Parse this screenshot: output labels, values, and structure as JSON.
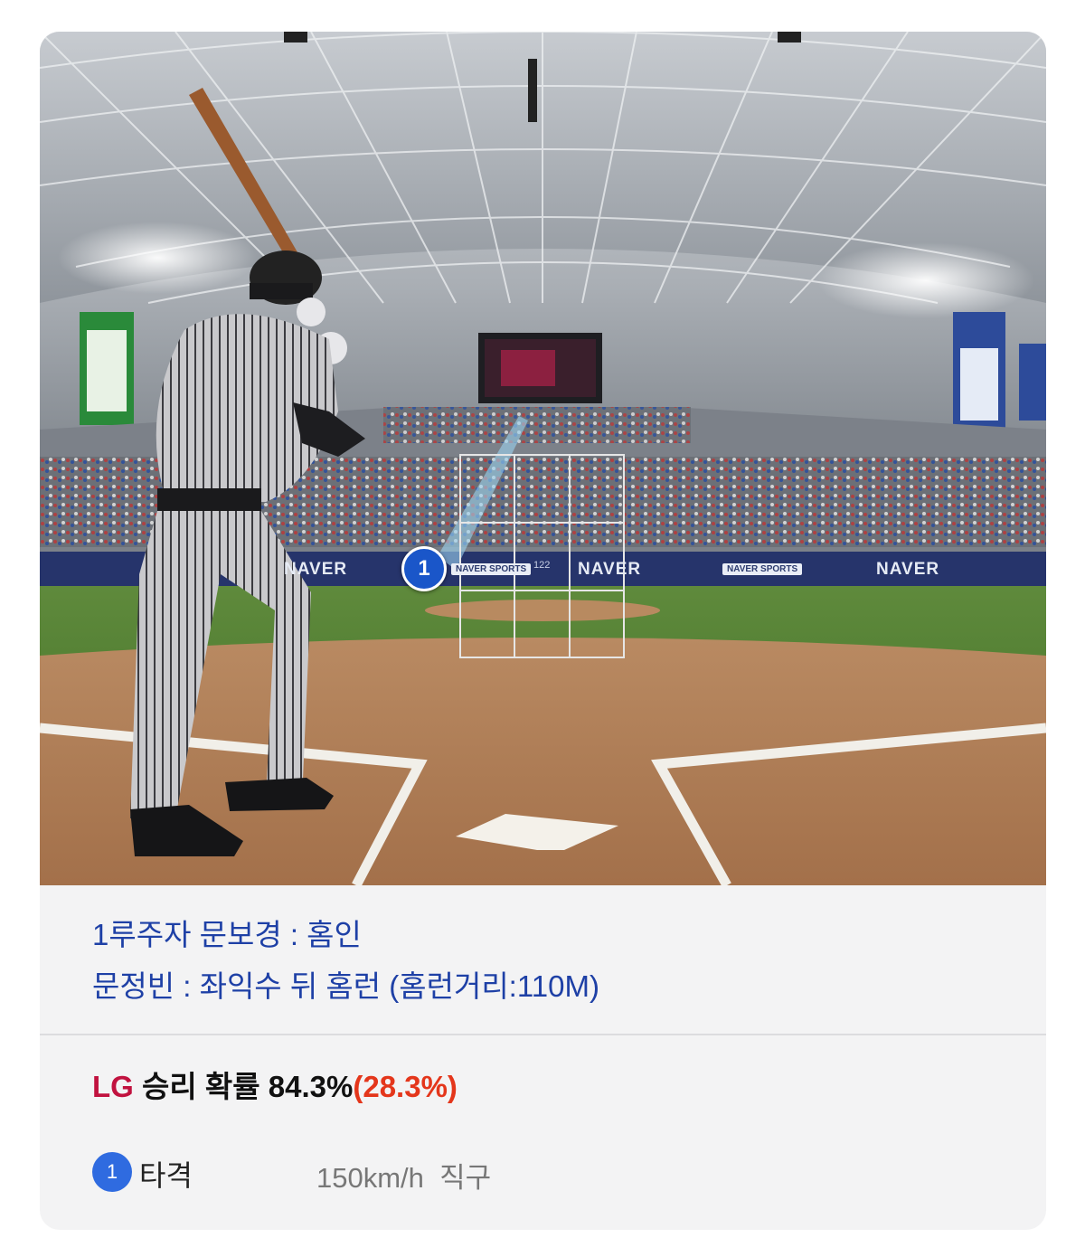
{
  "scene": {
    "banners": [
      "NAVER",
      "NAVER",
      "NAVER",
      "NAVER"
    ],
    "banner_small": [
      "NAVER SPORTS",
      "NAVER SPORTS"
    ],
    "fence_number": "122",
    "ball_marker_number": "1"
  },
  "events": [
    "1루주자 문보경 : 홈인",
    "문정빈 : 좌익수 뒤 홈런 (홈런거리:110M)"
  ],
  "win_probability": {
    "team": "LG",
    "label": "승리 확률",
    "value": "84.3%",
    "delta": "(28.3%)"
  },
  "pitch": {
    "number": "1",
    "result": "타격",
    "speed": "150km/h",
    "type": "직구"
  },
  "colors": {
    "event_text": "#1e40a6",
    "team": "#c1123f",
    "delta": "#e4361b",
    "marker": "#1a56c9"
  }
}
